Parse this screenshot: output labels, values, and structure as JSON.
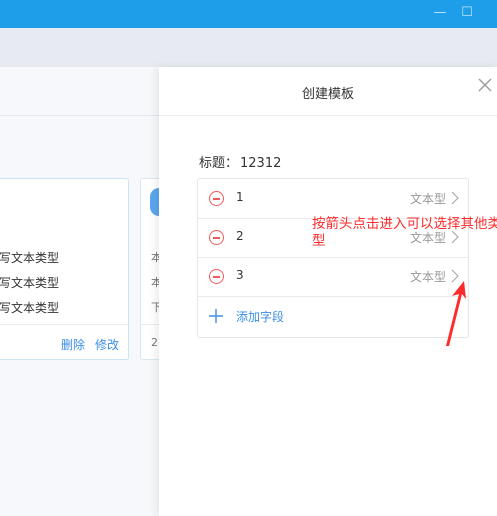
{
  "window": {
    "minimize_glyph": "—",
    "maximize_glyph": "☐"
  },
  "background": {
    "card1": {
      "rows": [
        "写文本类型",
        "写文本类型",
        "写文本类型"
      ],
      "delete_label": "删除",
      "edit_label": "修改"
    },
    "card2": {
      "rows": [
        "本",
        "本",
        "下"
      ],
      "footer": "2"
    }
  },
  "dialog": {
    "title": "创建模板",
    "title_field": {
      "label": "标题：",
      "value": "12312"
    },
    "fields": [
      {
        "name": "1",
        "type": "文本型"
      },
      {
        "name": "2",
        "type": "文本型"
      },
      {
        "name": "3",
        "type": "文本型"
      }
    ],
    "add_field_label": "添加字段"
  },
  "annotation": {
    "text": "按箭头点击进入可以选择其他类型"
  },
  "colors": {
    "titlebar": "#1e9de9",
    "accent": "#3a8ee6",
    "danger": "#f05a5a",
    "annotation": "#ff2a2a"
  }
}
